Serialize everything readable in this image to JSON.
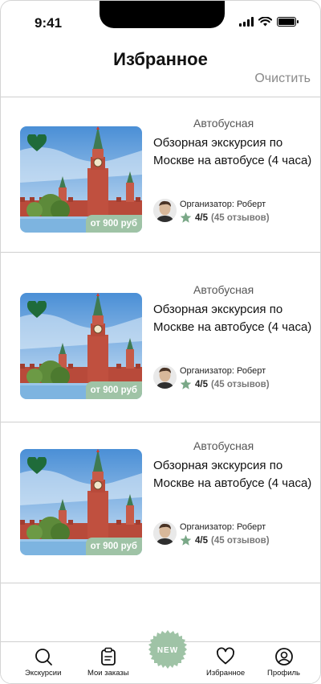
{
  "status_bar": {
    "time": "9:41"
  },
  "header": {
    "title": "Избранное",
    "clear_label": "Очистить"
  },
  "tours": [
    {
      "category": "Автобусная",
      "title": "Обзорная экскурсия по Москве на автобусе (4 часа)",
      "price": "от 900 руб",
      "organizer": "Организатор: Роберт",
      "rating": "4/5",
      "reviews": "(45 отзывов)",
      "favorite": true
    },
    {
      "category": "Автобусная",
      "title": "Обзорная экскурсия по Москве на автобусе (4 часа)",
      "price": "от 900 руб",
      "organizer": "Организатор: Роберт",
      "rating": "4/5",
      "reviews": "(45 отзывов)",
      "favorite": true
    },
    {
      "category": "Автобусная",
      "title": "Обзорная экскурсия по Москве на автобусе (4 часа)",
      "price": "от 900 руб",
      "organizer": "Организатор: Роберт",
      "rating": "4/5",
      "reviews": "(45 отзывов)",
      "favorite": true
    }
  ],
  "bottom_nav": {
    "items": [
      {
        "label": "Экскурсии",
        "icon": "search-icon"
      },
      {
        "label": "Мои заказы",
        "icon": "clipboard-icon"
      },
      {
        "label": "Избранное",
        "icon": "heart-icon"
      },
      {
        "label": "Профиль",
        "icon": "user-icon"
      }
    ],
    "center_badge": "NEW"
  },
  "colors": {
    "accent_green": "#1f6b3a",
    "badge_green": "#9fc3a6",
    "star_green": "#7aa887",
    "muted_text": "#8a8a8a"
  }
}
